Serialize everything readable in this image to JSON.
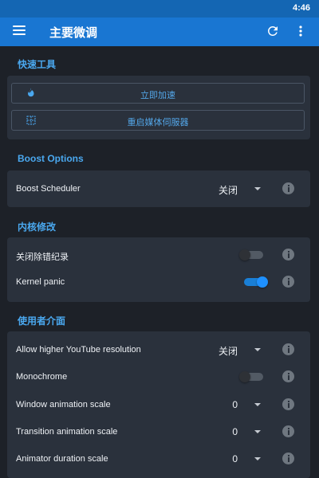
{
  "status_bar": {
    "time": "4:46"
  },
  "app_bar": {
    "title": "主要微调",
    "icons": [
      "menu-icon",
      "refresh-icon",
      "more-vert-icon"
    ]
  },
  "colors": {
    "app_bar": "#1976d2",
    "accent": "#4aa8ef",
    "background": "#1d2128",
    "card": "#2a313c",
    "toggle_on": "#1e90ff"
  },
  "quick_tools": {
    "title": "快速工具",
    "buttons": [
      {
        "label": "立即加速",
        "icon": "flame-icon"
      },
      {
        "label": "重启媒体伺服器",
        "icon": "grid-icon"
      }
    ]
  },
  "boost_options": {
    "title": "Boost Options",
    "rows": [
      {
        "label": "Boost Scheduler",
        "value": "关闭"
      }
    ]
  },
  "kernel": {
    "title": "内核修改",
    "rows": [
      {
        "label": "关闭除错纪录",
        "toggle": "off"
      },
      {
        "label": "Kernel panic",
        "toggle": "on"
      }
    ]
  },
  "ui": {
    "title": "使用者介面",
    "rows": [
      {
        "label": "Allow higher YouTube resolution",
        "value": "关闭"
      },
      {
        "label": "Monochrome",
        "toggle": "off"
      },
      {
        "label": "Window animation scale",
        "value": "0"
      },
      {
        "label": "Transition animation scale",
        "value": "0"
      },
      {
        "label": "Animator duration scale",
        "value": "0"
      }
    ]
  }
}
